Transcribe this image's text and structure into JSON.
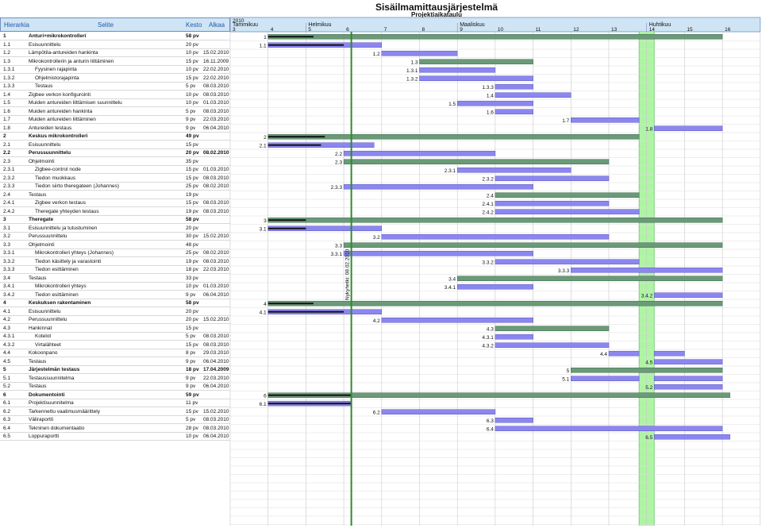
{
  "title": "Sisäilmamittausjärjestelmä",
  "subtitle": "Projektiaikataulu",
  "columns": {
    "hierarkia": "Hierarkia",
    "selite": "Selite",
    "kesto": "Kesto",
    "alkaa": "Alkaa"
  },
  "chart_data": {
    "type": "gantt",
    "year": "2010",
    "months": [
      {
        "name": "Tammikuu",
        "week": 3
      },
      {
        "name": "Helmikuu",
        "week": 5
      },
      {
        "name": "Maaliskuu",
        "week": 9
      },
      {
        "name": "Huhtikuu",
        "week": 14
      }
    ],
    "weeks": [
      3,
      4,
      5,
      6,
      7,
      8,
      9,
      10,
      11,
      12,
      13,
      14,
      15,
      16
    ],
    "today_label": "Nykyhetki: 08.02.2010",
    "today_week": 6.2,
    "highlight_weeks": [
      13.8,
      14.2
    ],
    "colors": {
      "task": "#8c87ef",
      "summary": "#6a9a78",
      "today": "#2e8b2e",
      "highlight": "#aef5a3",
      "header": "#cfe5f5"
    },
    "rows": [
      {
        "id": "1",
        "name": "Anturi+mikrokontrolleri",
        "dur": "58 pv",
        "start": "",
        "bold": true,
        "bs": 4,
        "be": 16,
        "prog": 1.2,
        "summary": true,
        "label": "1"
      },
      {
        "id": "1.1",
        "name": "Esisuunnittelu",
        "dur": "20 pv",
        "start": "",
        "bs": 4,
        "be": 7,
        "prog": 2,
        "label": "1.1"
      },
      {
        "id": "1.2",
        "name": "Lämpötila-antureiden hankinta",
        "dur": "10 pv",
        "start": "15.02.2010",
        "bs": 7,
        "be": 9,
        "label": "1.2"
      },
      {
        "id": "1.3",
        "name": "Mikrokontrollerin ja anturin liittäminen",
        "dur": "15 pv",
        "start": "16.11.2009",
        "bs": 8,
        "be": 11,
        "summary": true,
        "label": "1.3"
      },
      {
        "id": "1.3.1",
        "name": "Fyysinen rajapinta",
        "dur": "10 pv",
        "start": "22.02.2010",
        "bs": 8,
        "be": 10,
        "indent": 1,
        "label": "1.3.1"
      },
      {
        "id": "1.3.2",
        "name": "Ohjelmistorajapinta",
        "dur": "15 pv",
        "start": "22.02.2010",
        "bs": 8,
        "be": 11,
        "indent": 1,
        "label": "1.3.2"
      },
      {
        "id": "1.3.3",
        "name": "Testaus",
        "dur": "5 pv",
        "start": "08.03.2010",
        "bs": 10,
        "be": 11,
        "indent": 1,
        "label": "1.3.3"
      },
      {
        "id": "1.4",
        "name": "Zigbee verkon konfigurointi",
        "dur": "10 pv",
        "start": "08.03.2010",
        "bs": 10,
        "be": 12,
        "label": "1.4"
      },
      {
        "id": "1.5",
        "name": "Muiden antureiden liittämisen suunnittelu",
        "dur": "10 pv",
        "start": "01.03.2010",
        "bs": 9,
        "be": 11,
        "label": "1.5"
      },
      {
        "id": "1.6",
        "name": "Muiden antureiden hankinta",
        "dur": "5 pv",
        "start": "08.03.2010",
        "bs": 10,
        "be": 11,
        "label": "1.6"
      },
      {
        "id": "1.7",
        "name": "Muiden antureiden liittäminen",
        "dur": "9 pv",
        "start": "22.03.2010",
        "bs": 12,
        "be": 13.8,
        "label": "1.7"
      },
      {
        "id": "1.8",
        "name": "Antureiden testaus",
        "dur": "9 pv",
        "start": "06.04.2010",
        "bs": 14.2,
        "be": 16,
        "label": "1.8"
      },
      {
        "id": "2",
        "name": "Keskus mikrokontrolleri",
        "dur": "49 pv",
        "start": "",
        "bold": true,
        "bs": 4,
        "be": 13.8,
        "prog": 1.5,
        "summary": true,
        "label": "2"
      },
      {
        "id": "2.1",
        "name": "Esisuunnittelu",
        "dur": "15 pv",
        "start": "",
        "bs": 4,
        "be": 6.8,
        "prog": 1.4,
        "label": "2.1"
      },
      {
        "id": "2.2",
        "name": "Perussuunnittelu",
        "dur": "20 pv",
        "start": "08.02.2010",
        "bold": true,
        "bs": 6,
        "be": 10,
        "label": "2.2"
      },
      {
        "id": "2.3",
        "name": "Ohjelmointi",
        "dur": "35 pv",
        "start": "",
        "bs": 6,
        "be": 13,
        "summary": true,
        "label": "2.3"
      },
      {
        "id": "2.3.1",
        "name": "Zigbee-control node",
        "dur": "15 pv",
        "start": "01.03.2010",
        "bs": 9,
        "be": 12,
        "indent": 1,
        "label": "2.3.1"
      },
      {
        "id": "2.3.2",
        "name": "Tiedon muokkaus",
        "dur": "15 pv",
        "start": "08.03.2010",
        "bs": 10,
        "be": 13,
        "indent": 1,
        "label": "2.3.2"
      },
      {
        "id": "2.3.3",
        "name": "Tiedon siirto theregateen (Johannes)",
        "dur": "25 pv",
        "start": "08.02.2010",
        "bs": 6,
        "be": 11,
        "indent": 1,
        "label": "2.3.3"
      },
      {
        "id": "2.4",
        "name": "Testaus",
        "dur": "19 pv",
        "start": "",
        "bs": 10,
        "be": 13.8,
        "summary": true,
        "label": "2.4"
      },
      {
        "id": "2.4.1",
        "name": "Zigbee verkon testaus",
        "dur": "15 pv",
        "start": "08.03.2010",
        "bs": 10,
        "be": 13,
        "indent": 1,
        "label": "2.4.1"
      },
      {
        "id": "2.4.2",
        "name": "Theregate yhteyden testaus",
        "dur": "19 pv",
        "start": "08.03.2010",
        "bs": 10,
        "be": 13.8,
        "indent": 1,
        "label": "2.4.2"
      },
      {
        "id": "3",
        "name": "Theregate",
        "dur": "58 pv",
        "start": "",
        "bold": true,
        "bs": 4,
        "be": 16,
        "prog": 1,
        "summary": true,
        "label": "3"
      },
      {
        "id": "3.1",
        "name": "Esisuunnittelu ja tutustuminen",
        "dur": "20 pv",
        "start": "",
        "bs": 4,
        "be": 7,
        "prog": 1,
        "label": "3.1"
      },
      {
        "id": "3.2",
        "name": "Perussuunnittelu",
        "dur": "30 pv",
        "start": "15.02.2010",
        "bs": 7,
        "be": 13,
        "label": "3.2"
      },
      {
        "id": "3.3",
        "name": "Ohjelmointi",
        "dur": "48 pv",
        "start": "",
        "bs": 6,
        "be": 16,
        "summary": true,
        "label": "3.3"
      },
      {
        "id": "3.3.1",
        "name": "Mikrokontrolleri yhteys (Johannes)",
        "dur": "25 pv",
        "start": "08.02.2010",
        "bs": 6,
        "be": 11,
        "indent": 1,
        "label": "3.3.1"
      },
      {
        "id": "3.3.2",
        "name": "Tiedon käsittely ja varastointi",
        "dur": "19 pv",
        "start": "08.03.2010",
        "bs": 10,
        "be": 13.8,
        "indent": 1,
        "label": "3.3.2"
      },
      {
        "id": "3.3.3",
        "name": "Tiedon esittäminen",
        "dur": "18 pv",
        "start": "22.03.2010",
        "bs": 12,
        "be": 16,
        "indent": 1,
        "label": "3.3.3"
      },
      {
        "id": "3.4",
        "name": "Testaus",
        "dur": "33 pv",
        "start": "",
        "bs": 9,
        "be": 16,
        "summary": true,
        "label": "3.4"
      },
      {
        "id": "3.4.1",
        "name": "Mikrokontrolleri yhteys",
        "dur": "10 pv",
        "start": "01.03.2010",
        "bs": 9,
        "be": 11,
        "indent": 1,
        "label": "3.4.1"
      },
      {
        "id": "3.4.2",
        "name": "Tiedon esittäminen",
        "dur": "9 pv",
        "start": "06.04.2010",
        "bs": 14.2,
        "be": 16,
        "indent": 1,
        "label": "3.4.2"
      },
      {
        "id": "4",
        "name": "Keskuksen rakentaminen",
        "dur": "58 pv",
        "start": "",
        "bold": true,
        "bs": 4,
        "be": 16,
        "prog": 1.2,
        "summary": true,
        "label": "4"
      },
      {
        "id": "4.1",
        "name": "Esisuunnittelu",
        "dur": "20 pv",
        "start": "",
        "bs": 4,
        "be": 7,
        "prog": 2,
        "label": "4.1"
      },
      {
        "id": "4.2",
        "name": "Perussuunnittelu",
        "dur": "20 pv",
        "start": "15.02.2010",
        "bs": 7,
        "be": 11,
        "label": "4.2"
      },
      {
        "id": "4.3",
        "name": "Hankinnat",
        "dur": "15 pv",
        "start": "",
        "bs": 10,
        "be": 13,
        "summary": true,
        "label": "4.3"
      },
      {
        "id": "4.3.1",
        "name": "Kotelot",
        "dur": "5 pv",
        "start": "08.03.2010",
        "bs": 10,
        "be": 11,
        "indent": 1,
        "label": "4.3.1"
      },
      {
        "id": "4.3.2",
        "name": "Virtalähteet",
        "dur": "15 pv",
        "start": "08.03.2010",
        "bs": 10,
        "be": 13,
        "indent": 1,
        "label": "4.3.2"
      },
      {
        "id": "4.4",
        "name": "Kokoonpano",
        "dur": "8 pv",
        "start": "29.03.2010",
        "bs": 13,
        "be": 13.8,
        "bs2": 14.2,
        "be2": 15,
        "label": "4.4"
      },
      {
        "id": "4.5",
        "name": "Testaus",
        "dur": "9 pv",
        "start": "06.04.2010",
        "bs": 14.2,
        "be": 16,
        "label": "4.5"
      },
      {
        "id": "5",
        "name": "Järjestelmän testaus",
        "dur": "18 pv",
        "start": "17.04.2009",
        "bold": true,
        "bs": 12,
        "be": 16,
        "summary": true,
        "label": "5"
      },
      {
        "id": "5.1",
        "name": "Testaussuunnitelma",
        "dur": "9 pv",
        "start": "22.03.2010",
        "bs": 12,
        "be": 13.8,
        "bs2": 14.2,
        "be2": 16,
        "label": "5.1"
      },
      {
        "id": "5.2",
        "name": "Testaus",
        "dur": "9 pv",
        "start": "06.04.2010",
        "bs": 14.2,
        "be": 16,
        "label": "5.2"
      },
      {
        "id": "6",
        "name": "Dokumentointi",
        "dur": "59 pv",
        "start": "",
        "bold": true,
        "bs": 4,
        "be": 16.2,
        "prog": 2.2,
        "summary": true,
        "label": "6"
      },
      {
        "id": "6.1",
        "name": "Projektisuunnitelma",
        "dur": "11 pv",
        "start": "",
        "bs": 4,
        "be": 6.2,
        "prog": 2.2,
        "label": "6.1"
      },
      {
        "id": "6.2",
        "name": "Tarkennettu vaatimusmäärittely",
        "dur": "15 pv",
        "start": "15.02.2010",
        "bs": 7,
        "be": 10,
        "label": "6.2"
      },
      {
        "id": "6.3",
        "name": "Väliraportti",
        "dur": "5 pv",
        "start": "08.03.2010",
        "bs": 10,
        "be": 11,
        "label": "6.3"
      },
      {
        "id": "6.4",
        "name": "Tekninen dokumentaatio",
        "dur": "28 pv",
        "start": "08.03.2010",
        "bs": 10,
        "be": 16,
        "label": "6.4"
      },
      {
        "id": "6.5",
        "name": "Loppuraportti",
        "dur": "10 pv",
        "start": "06.04.2010",
        "bs": 14.2,
        "be": 16.2,
        "label": "6.5"
      }
    ]
  }
}
